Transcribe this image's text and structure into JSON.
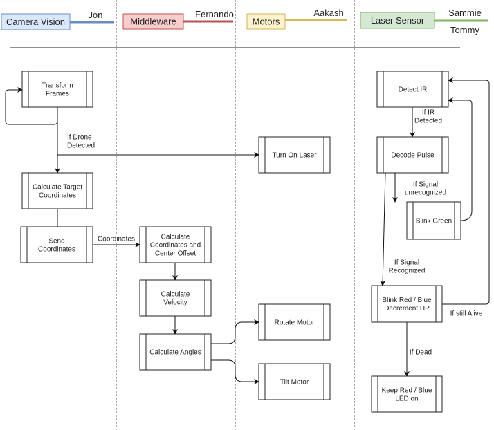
{
  "lanes": [
    {
      "title": "Camera Vision",
      "owners": [
        "Jon"
      ],
      "fill": "#dae8fc",
      "stroke": "#6c8ebf"
    },
    {
      "title": "Middleware",
      "owners": [
        "Fernando"
      ],
      "fill": "#f8cecc",
      "stroke": "#b85450"
    },
    {
      "title": "Motors",
      "owners": [
        "Aakash"
      ],
      "fill": "#fff2cc",
      "stroke": "#d6b656"
    },
    {
      "title": "Laser Sensor",
      "owners": [
        "Sammie",
        "Tommy"
      ],
      "fill": "#d5e8d4",
      "stroke": "#82b366"
    }
  ],
  "nodes": {
    "transform": [
      "Transform",
      "Frames"
    ],
    "calc_target": [
      "Calculate Target",
      "Coordinates"
    ],
    "send_coords": [
      "Send",
      "Coordinates"
    ],
    "calc_offset": [
      "Calculate",
      "Coordinates and",
      "Center Offset"
    ],
    "calc_velocity": [
      "Calculate",
      "Velocity"
    ],
    "calc_angles": [
      "Calculate Angles"
    ],
    "turn_on_laser": [
      "Turn On Laser"
    ],
    "rotate_motor": [
      "Rotate Motor"
    ],
    "tilt_motor": [
      "Tilt Motor"
    ],
    "detect_ir": [
      "Detect IR"
    ],
    "decode_pulse": [
      "Decode Pulse"
    ],
    "blink_green": [
      "Blink Green"
    ],
    "blink_red": [
      "Blink Red / Blue",
      "Decrement HP"
    ],
    "keep_red": [
      "Keep Red / Blue",
      "LED on"
    ]
  },
  "edge_labels": {
    "drone_detected": [
      "If Drone",
      "Detected"
    ],
    "coordinates": [
      "Coordinates"
    ],
    "ir_detected": [
      "If IR",
      "Detected"
    ],
    "unrecognized": [
      "If Signal",
      "unrecognized"
    ],
    "recognized": [
      "If Signal",
      "Recognized"
    ],
    "still_alive": [
      "If still Alive"
    ],
    "dead": [
      "If Dead"
    ]
  }
}
